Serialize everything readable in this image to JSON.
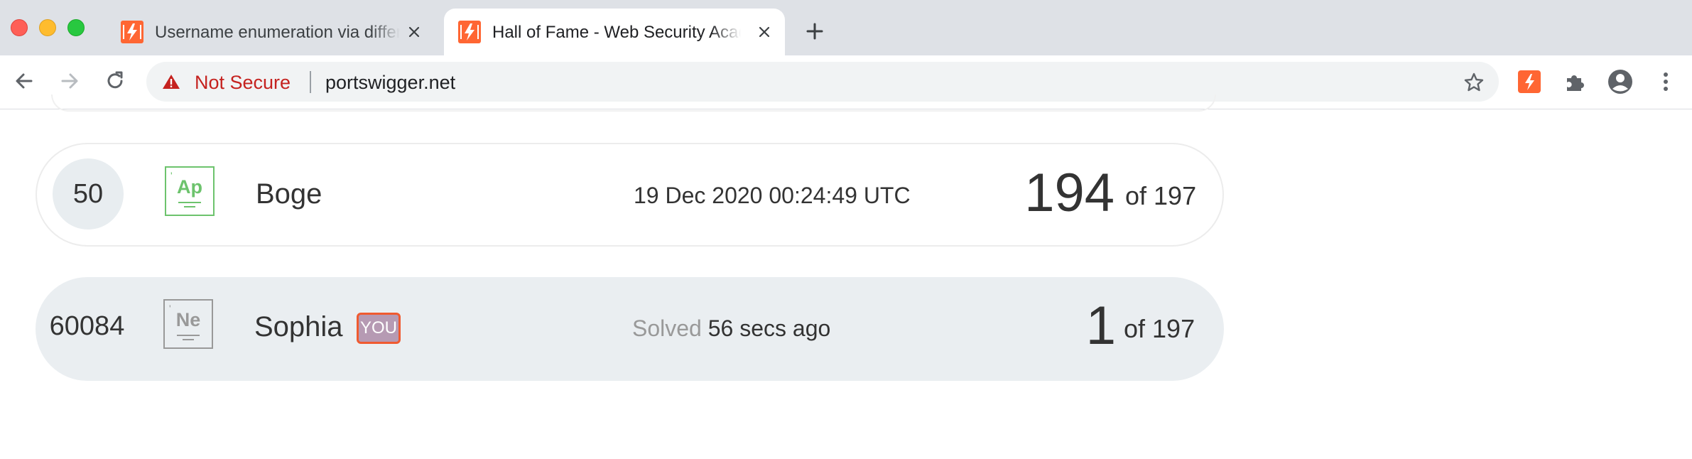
{
  "window": {
    "controls": [
      "close",
      "minimize",
      "zoom"
    ]
  },
  "tabs": [
    {
      "title": "Username enumeration via different responses",
      "active": false,
      "favicon": "portswigger-favicon"
    },
    {
      "title": "Hall of Fame - Web Security Academy",
      "active": true,
      "favicon": "portswigger-favicon"
    }
  ],
  "toolbar": {
    "security_label": "Not Secure",
    "url": "portswigger.net"
  },
  "leaderboard": {
    "rows": [
      {
        "rank": "50",
        "badge_symbol": "Ap",
        "badge_tick": "'",
        "name": "Boge",
        "date": "19 Dec 2020 00:24:49 UTC",
        "score": "194",
        "of_total": "of 197"
      },
      {
        "rank": "60084",
        "badge_symbol": "Ne",
        "badge_tick": "'",
        "name": "Sophia",
        "you_label": "YOU",
        "solved_prefix": "Solved",
        "solved_time": "56 secs ago",
        "score": "1",
        "of_total": "of 197"
      }
    ]
  },
  "colors": {
    "brand_orange": "#ff6633",
    "not_secure_red": "#c5221f",
    "badge_green": "#6dc36d",
    "badge_grey": "#999999",
    "you_badge_fill": "#b69ab3",
    "you_badge_border": "#f05a30",
    "highlight_row": "#eaeef1"
  }
}
